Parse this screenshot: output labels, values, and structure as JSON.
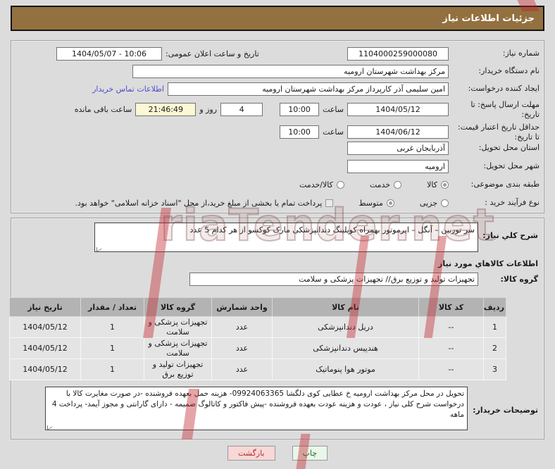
{
  "header": {
    "title": "جزئیات اطلاعات نیاز"
  },
  "form": {
    "need_number": {
      "label": "شماره نیاز:",
      "value": "1104000259000080"
    },
    "announce": {
      "label": "تاریخ و ساعت اعلان عمومی:",
      "value": "1404/05/07 - 10:06"
    },
    "buyer_org": {
      "label": "نام دستگاه خریدار:",
      "value": "مرکز بهداشت شهرستان ارومیه"
    },
    "request_creator": {
      "label": "ایجاد کننده درخواست:",
      "value": "امین سلیمی آذر کارپرداز مرکز بهداشت شهرستان ارومیه",
      "contact_link": "اطلاعات تماس خریدار"
    },
    "reply_deadline": {
      "label": "مهلت ارسال پاسخ: تا تاریخ:",
      "date": "1404/05/12",
      "time_label": "ساعت",
      "time": "10:00",
      "days": "4",
      "days_label": "روز و",
      "remaining": "21:46:49",
      "remaining_label": "ساعت باقی مانده"
    },
    "price_validity": {
      "label": "حداقل تاریخ اعتبار قیمت: تا تاریخ:",
      "date": "1404/06/12",
      "time_label": "ساعت",
      "time": "10:00"
    },
    "delivery_province": {
      "label": "استان محل تحویل:",
      "value": "آذربایجان غربی"
    },
    "delivery_city": {
      "label": "شهر محل تحویل:",
      "value": "ارومیه"
    },
    "subject_class": {
      "label": "طبقه بندی موضوعی:",
      "options": [
        {
          "label": "کالا",
          "selected": true
        },
        {
          "label": "خدمت",
          "selected": false
        },
        {
          "label": "کالا/خدمت",
          "selected": false
        }
      ]
    },
    "purchase_process": {
      "label": "نوع فرآیند خرید :",
      "options": [
        {
          "label": "جزیی",
          "selected": false
        },
        {
          "label": "متوسط",
          "selected": true
        }
      ],
      "checkbox": {
        "label": "پرداخت تمام یا بخشی از مبلغ خرید،از محل \"اسناد خزانه اسلامی\" خواهد بود.",
        "checked": false
      }
    }
  },
  "need_desc": {
    "label": "شرح کلي نیاز:",
    "value": "سر توربین – آنگل – ایرموتور بهمراه کوپلینگ دندانپزشکی مارک کوکسو  از هر کدام 5 عدد"
  },
  "goods_section": {
    "heading": "اطلاعات کالاهاي مورد نیاز",
    "group_label": "گروه کالا:",
    "group_value": "تجهیزات تولید و توزیع برق// تجهیزات پزشکی و سلامت",
    "table": {
      "headers": [
        "ردیف",
        "کد کالا",
        "نام کالا",
        "واحد شمارش",
        "گروه کالا",
        "تعداد / مقدار",
        "تاریخ نیاز"
      ],
      "rows": [
        [
          "1",
          "--",
          "دریل دندانپزشکی",
          "عدد",
          "تجهیزات پزشکی و سلامت",
          "1",
          "1404/05/12"
        ],
        [
          "2",
          "--",
          "هندپیس دندانپزشکی",
          "عدد",
          "تجهیزات پزشکی و سلامت",
          "1",
          "1404/05/12"
        ],
        [
          "3",
          "--",
          "موتور هوا پنوماتیک",
          "عدد",
          "تجهیزات تولید و توزیع برق",
          "1",
          "1404/05/12"
        ]
      ]
    }
  },
  "buyer_notes": {
    "label": "توضیحات خریدار:",
    "value": "تحویل در محل مرکز بهداشت ارومیه خ عطایی کوی دلگشا 09924063365- هزینه حمل بعهده فروشنده -در صورت مغایرت کالا با درخواست شرح کلی نیاز ، عودت و هزینه عودت بعهده فروشنده -پیش فاکتور و کاتالوگ ضمیمه -   دارای گارانتی و مجوز آیمد- پرداخت 4 ماهه"
  },
  "buttons": {
    "print": "چاپ",
    "back": "بازگشت"
  },
  "watermark": {
    "text": "riaTender.net"
  },
  "colors": {
    "header_bg": "#93703f",
    "link": "#4d4dcc",
    "remaining_bg": "#fcf8d5",
    "print_btn": "#e9f6e9",
    "back_btn": "#f8d7d7"
  }
}
